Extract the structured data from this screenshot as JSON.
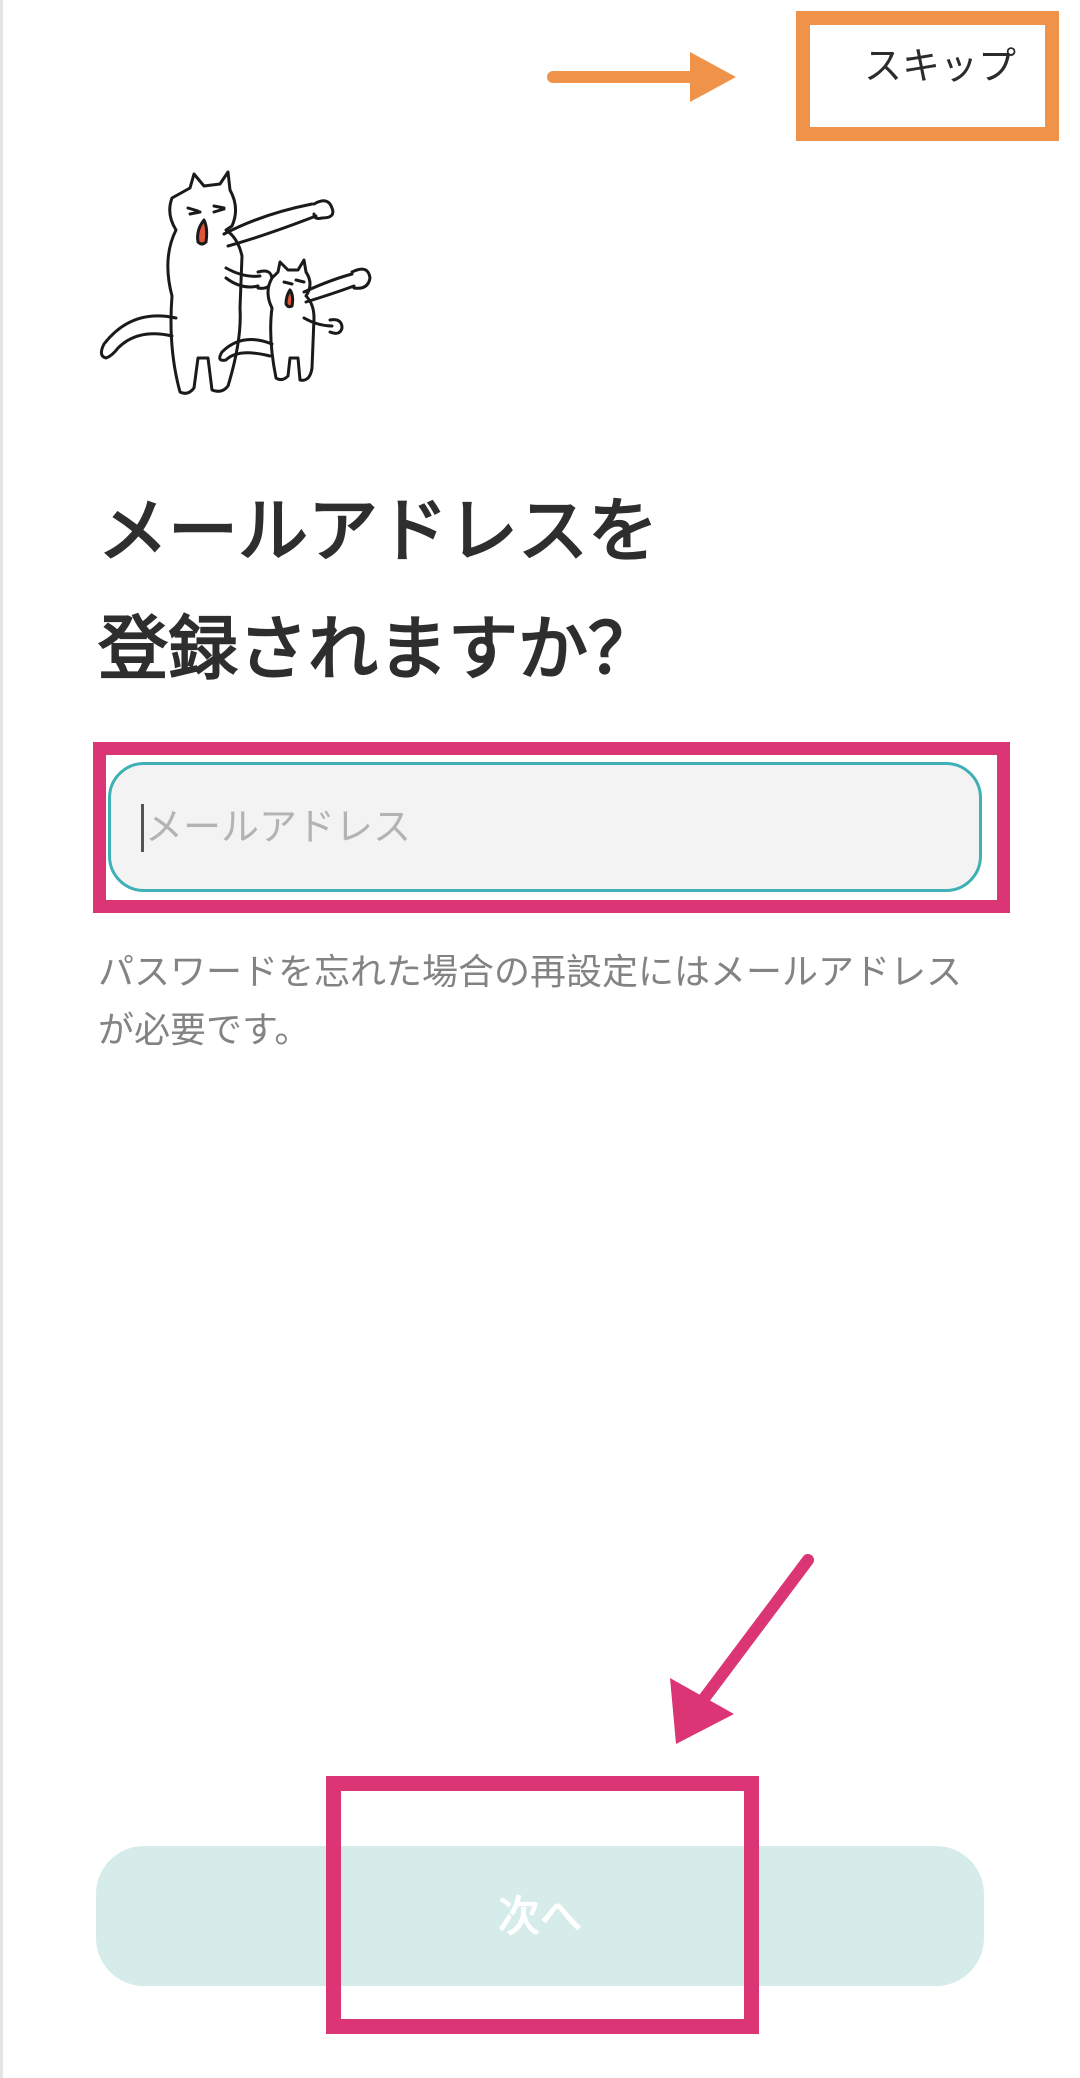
{
  "header": {
    "skip_label": "スキップ"
  },
  "main": {
    "title_line1": "メールアドレスを",
    "title_line2": "登録されますか？",
    "email_placeholder": "メールアドレス",
    "note": "パスワードを忘れた場合の再設定にはメールアドレスが必要です。"
  },
  "footer": {
    "next_label": "次へ"
  },
  "colors": {
    "input_border": "#3fb0b5",
    "button_bg": "#d6ecea",
    "annotation_orange": "#f0934a",
    "annotation_pink": "#dc3576"
  }
}
